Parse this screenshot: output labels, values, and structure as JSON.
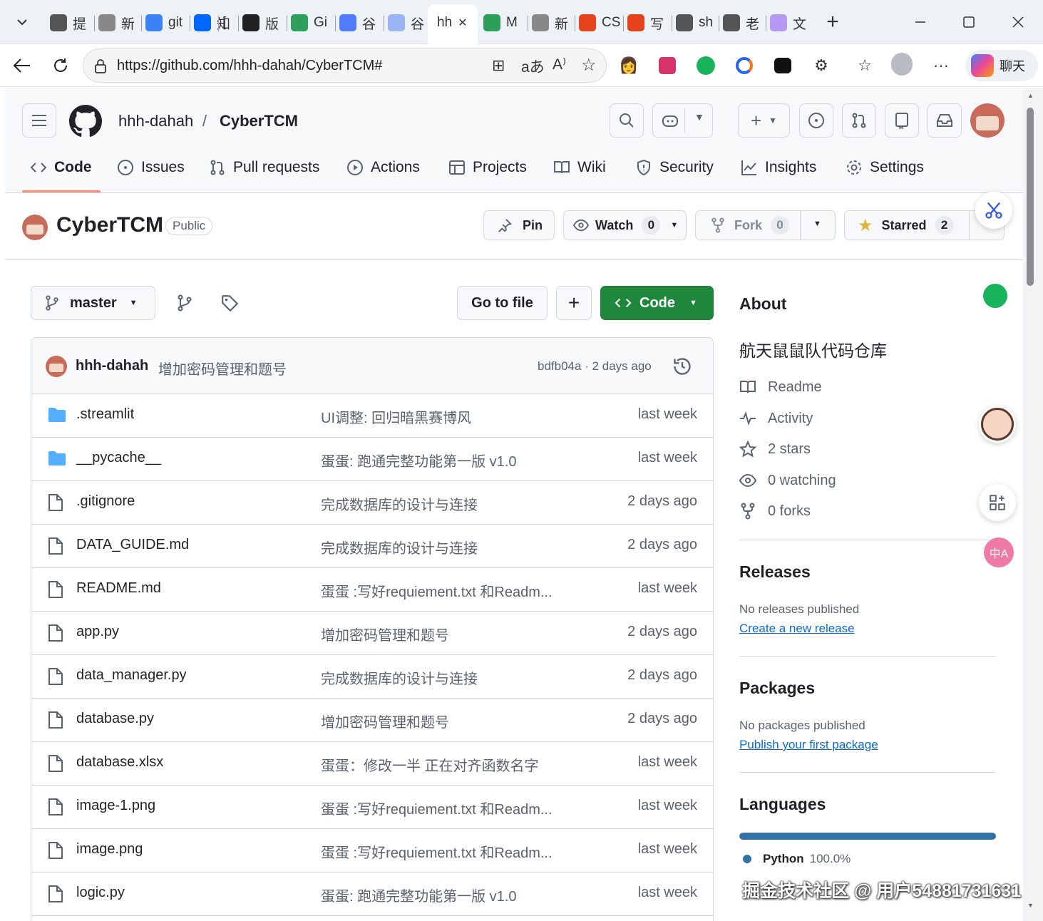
{
  "browser": {
    "tabs": [
      {
        "label": "提",
        "icon": "github-icon"
      },
      {
        "label": "新",
        "icon": "newtab-icon"
      },
      {
        "label": "git",
        "icon": "search-icon"
      },
      {
        "label": "知",
        "icon": "zhihu-icon"
      },
      {
        "label": "[",
        "icon": "bracket"
      },
      {
        "label": "版",
        "icon": "linux-icon"
      },
      {
        "label": "Gi",
        "icon": "code-icon"
      },
      {
        "label": "谷",
        "icon": "gemini-icon"
      },
      {
        "label": "谷",
        "icon": "gemini-light-icon"
      },
      {
        "label": "hh",
        "icon": "active"
      },
      {
        "label": "M",
        "icon": "code-icon"
      },
      {
        "label": "新",
        "icon": "newtab-icon"
      },
      {
        "label": "CS",
        "icon": "csdn-icon"
      },
      {
        "label": "写",
        "icon": "csdn-icon"
      },
      {
        "label": "sh",
        "icon": "globe-icon"
      },
      {
        "label": "老",
        "icon": "globe-icon"
      },
      {
        "label": "文",
        "icon": "swirl-icon"
      }
    ],
    "url": "https://github.com/hhh-dahah/CyberTCM#",
    "chat_label": "聊天"
  },
  "header": {
    "owner": "hhh-dahah",
    "slash": "/",
    "repo": "CyberTCM"
  },
  "nav": {
    "code": "Code",
    "issues": "Issues",
    "pulls": "Pull requests",
    "actions": "Actions",
    "projects": "Projects",
    "wiki": "Wiki",
    "security": "Security",
    "insights": "Insights",
    "settings": "Settings"
  },
  "repo": {
    "name": "CyberTCM",
    "visibility": "Public",
    "pin": "Pin",
    "watch": "Watch",
    "watch_count": "0",
    "fork": "Fork",
    "fork_count": "0",
    "starred": "Starred",
    "star_count": "2"
  },
  "toolbar": {
    "branch": "master",
    "goto_file": "Go to file",
    "add": "+",
    "code": "Code"
  },
  "commit": {
    "author": "hhh-dahah",
    "message": "增加密码管理和题号",
    "hash_time": "bdfb04a · 2 days ago"
  },
  "files": [
    {
      "name": ".streamlit",
      "type": "folder",
      "message": "UI调整: 回归暗黑赛博风",
      "date": "last week"
    },
    {
      "name": "__pycache__",
      "type": "folder",
      "message": "蛋蛋: 跑通完整功能第一版 v1.0",
      "date": "last week"
    },
    {
      "name": ".gitignore",
      "type": "file",
      "message": "完成数据库的设计与连接",
      "date": "2 days ago"
    },
    {
      "name": "DATA_GUIDE.md",
      "type": "file",
      "message": "完成数据库的设计与连接",
      "date": "2 days ago"
    },
    {
      "name": "README.md",
      "type": "file",
      "message": "蛋蛋 :写好requiement.txt 和Readm...",
      "date": "last week"
    },
    {
      "name": "app.py",
      "type": "file",
      "message": "增加密码管理和题号",
      "date": "2 days ago"
    },
    {
      "name": "data_manager.py",
      "type": "file",
      "message": "完成数据库的设计与连接",
      "date": "2 days ago"
    },
    {
      "name": "database.py",
      "type": "file",
      "message": "增加密码管理和题号",
      "date": "2 days ago"
    },
    {
      "name": "database.xlsx",
      "type": "file",
      "message": "蛋蛋：修改一半 正在对齐函数名字",
      "date": "last week"
    },
    {
      "name": "image-1.png",
      "type": "file",
      "message": "蛋蛋 :写好requiement.txt 和Readm...",
      "date": "last week"
    },
    {
      "name": "image.png",
      "type": "file",
      "message": "蛋蛋 :写好requiement.txt 和Readm...",
      "date": "last week"
    },
    {
      "name": "logic.py",
      "type": "file",
      "message": "蛋蛋: 跑通完整功能第一版 v1.0",
      "date": "last week"
    }
  ],
  "about": {
    "heading": "About",
    "description": "航天鼠鼠队代码仓库",
    "readme": "Readme",
    "activity": "Activity",
    "stars": "2 stars",
    "watching": "0 watching",
    "forks": "0 forks"
  },
  "releases": {
    "heading": "Releases",
    "none": "No releases published",
    "link": "Create a new release"
  },
  "packages": {
    "heading": "Packages",
    "none": "No packages published",
    "link": "Publish your first package"
  },
  "languages": {
    "heading": "Languages",
    "items": [
      {
        "name": "Python",
        "percent": "100.0%",
        "color": "#3572A5",
        "fraction": 1.0
      }
    ]
  },
  "watermark": "掘金技术社区 @ 用户54881731631",
  "colors": {
    "green": "#1f883d",
    "link": "#0969da",
    "folder": "#54aeff"
  }
}
